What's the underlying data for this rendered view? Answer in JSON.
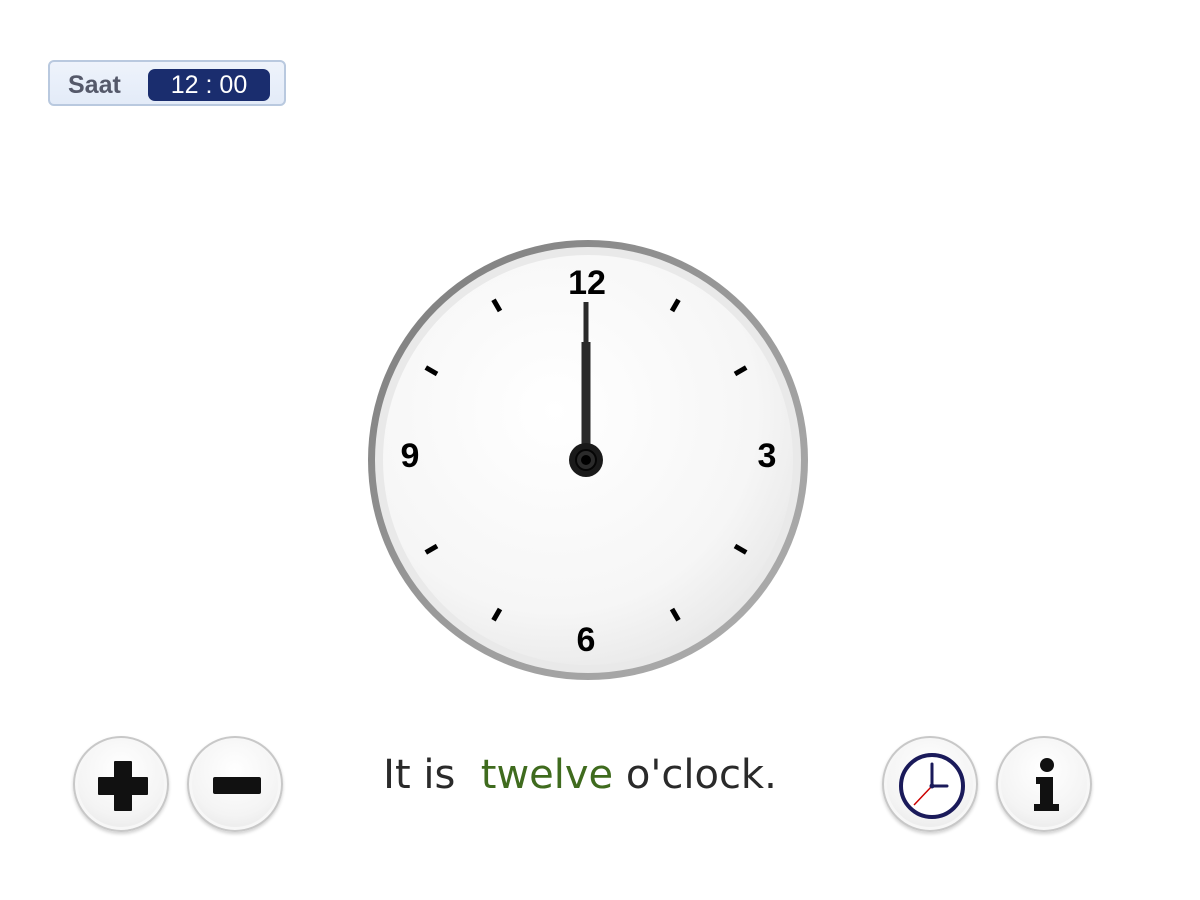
{
  "time_display": {
    "label": "Saat",
    "value": "12 : 00",
    "hours": 12,
    "minutes": 0
  },
  "clock": {
    "numerals": [
      "12",
      "3",
      "6",
      "9"
    ]
  },
  "sentence": {
    "prefix": "It is",
    "hour_word": "twelve",
    "suffix": "o'clock."
  },
  "buttons": {
    "plus": "plus-icon",
    "minus": "minus-icon",
    "clock": "clock-icon",
    "info": "info-icon"
  },
  "colors": {
    "badge_bg": "#1a2d6e",
    "hour_word": "#3f6b1e",
    "clock_icon_ring": "#1a1a5a",
    "clock_icon_second_hand": "#cc0000"
  }
}
